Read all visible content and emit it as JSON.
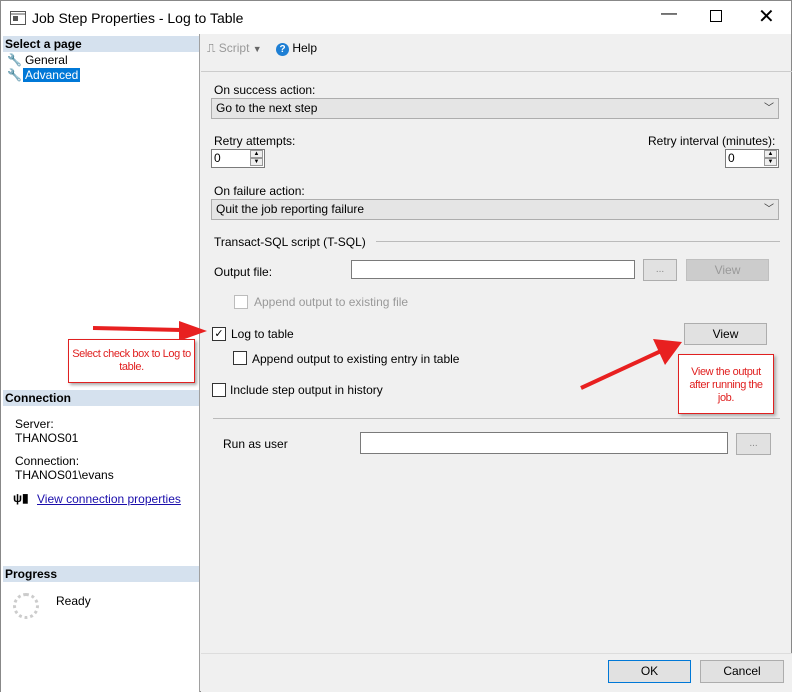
{
  "window": {
    "title": "Job Step Properties - Log to Table",
    "minimize_icon": "minimize-icon",
    "maximize_icon": "maximize-icon",
    "close_icon": "close-icon"
  },
  "sidebar": {
    "select_page_header": "Select a page",
    "pages": [
      {
        "label": "General"
      },
      {
        "label": "Advanced",
        "selected": true
      }
    ],
    "connection_header": "Connection",
    "server_label": "Server:",
    "server_value": "THANOS01",
    "connection_label": "Connection:",
    "connection_value": "THANOS01\\evans",
    "view_connection_link": "View connection properties",
    "progress_header": "Progress",
    "progress_status": "Ready"
  },
  "toolbar": {
    "script_label": "Script",
    "help_label": "Help"
  },
  "form": {
    "on_success_label": "On success action:",
    "on_success_value": "Go to the next step",
    "retry_attempts_label": "Retry attempts:",
    "retry_attempts_value": "0",
    "retry_interval_label": "Retry interval (minutes):",
    "retry_interval_value": "0",
    "on_failure_label": "On failure action:",
    "on_failure_value": "Quit the job reporting failure",
    "tsql_section": "Transact-SQL script (T-SQL)",
    "output_file_label": "Output file:",
    "output_file_value": "",
    "browse_label": "...",
    "view_label": "View",
    "append_output_file_label": "Append output to existing file",
    "log_to_table_label": "Log to table",
    "log_to_table_checked": true,
    "view_table_label": "View",
    "append_entry_label": "Append output to existing entry in table",
    "include_history_label": "Include step output in history",
    "run_as_user_label": "Run as user",
    "run_as_user_value": "",
    "run_as_browse": "..."
  },
  "footer": {
    "ok_label": "OK",
    "cancel_label": "Cancel"
  },
  "annotations": {
    "note1": "Select check box to Log to table.",
    "note2": "View the output after running the job.",
    "color": "#e02020"
  }
}
